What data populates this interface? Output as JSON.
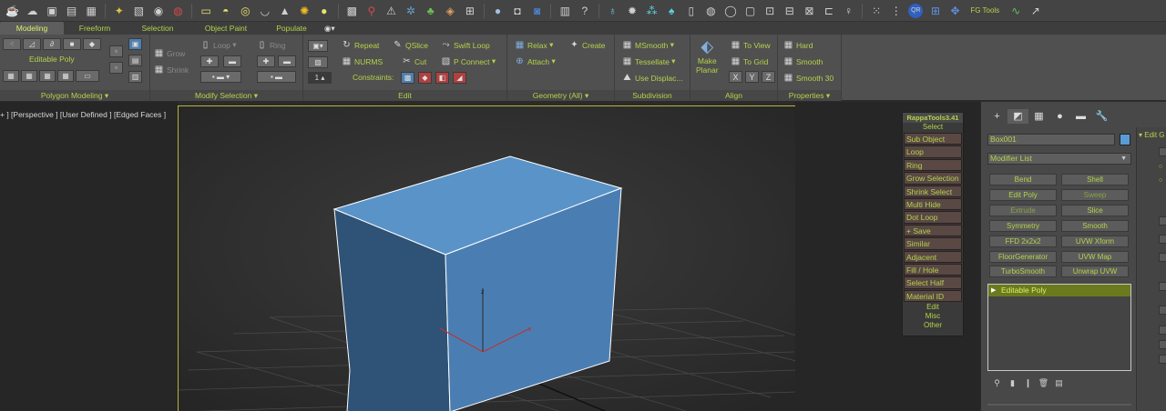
{
  "toolbar": {
    "icons": [
      "teapot-icon",
      "cloud-icon",
      "render-frame-icon",
      "list-icon",
      "layers-icon",
      "magnet-icon",
      "scene-icon",
      "camera-icon",
      "box-icon",
      "dome-icon",
      "ring-icon",
      "bowl-icon",
      "cone-icon",
      "sun-icon",
      "sphere-icon",
      "checker-icon",
      "lollipop-icon",
      "tripod-icon",
      "gear-icon",
      "plant-icon",
      "fish-icon",
      "hdri-icon",
      "ball-icon",
      "camera-gear-icon",
      "render-icon",
      "panel-icon",
      "help-icon",
      "bulb-icon",
      "sun2-icon",
      "grass-icon",
      "tree-icon",
      "book-icon",
      "hole-icon",
      "ring2-icon",
      "frame-icon",
      "crop-icon",
      "fit-icon",
      "expand-icon",
      "minimize-icon",
      "lamp-icon",
      "grid-icon",
      "dots-icon",
      "qr-icon",
      "matrix-icon",
      "move-icon"
    ],
    "fg_tools_label": "FG Tools"
  },
  "ribbon_tabs": [
    {
      "label": "Modeling"
    },
    {
      "label": "Freeform"
    },
    {
      "label": "Selection"
    },
    {
      "label": "Object Paint"
    },
    {
      "label": "Populate"
    }
  ],
  "ribbon": {
    "polygon_modeling": {
      "editable_poly": "Editable Poly",
      "title": "Polygon Modeling"
    },
    "modify_selection": {
      "grow": "Grow",
      "shrink": "Shrink",
      "loop": "Loop",
      "ring": "Ring",
      "title": "Modify Selection"
    },
    "edit": {
      "repeat": "Repeat",
      "qslice": "QSlice",
      "swift_loop": "Swift Loop",
      "nurms": "NURMS",
      "cut": "Cut",
      "p_connect": "P Connect",
      "constraints": "Constraints:",
      "spinner_value": "1",
      "title": "Edit"
    },
    "geometry": {
      "relax": "Relax",
      "create": "Create",
      "attach": "Attach",
      "title": "Geometry (All)"
    },
    "subdivision": {
      "msmooth": "MSmooth",
      "tessellate": "Tessellate",
      "use_displace": "Use Displac...",
      "title": "Subdivision"
    },
    "align": {
      "make_planar": "Make",
      "make_planar2": "Planar",
      "to_view": "To View",
      "to_grid": "To Grid",
      "x": "X",
      "y": "Y",
      "z": "Z",
      "title": "Align"
    },
    "properties": {
      "hard": "Hard",
      "smooth": "Smooth",
      "smooth30": "Smooth 30",
      "title": "Properties"
    }
  },
  "viewport": {
    "label": "+ ] [Perspective ] [User Defined ] [Edged Faces ]",
    "gizmo_x": "x",
    "gizmo_z": "z",
    "box_color": "#5b9bd5"
  },
  "rappatools": {
    "title": "RappaTools3.41",
    "select_label": "Select",
    "items": [
      "Sub Object",
      "Loop",
      "Ring",
      "Grow Selection",
      "Shrink Select",
      "Multi Hide",
      "Dot Loop",
      "+ Save",
      "Similar",
      "Adjacent",
      "Fill / Hole",
      "Select Half",
      "Material ID"
    ],
    "edit_label": "Edit",
    "misc_label": "Misc",
    "other_label": "Other"
  },
  "command_panel": {
    "object_name": "Box001",
    "modifier_list": "Modifier List",
    "modifiers": [
      [
        "Bend",
        "Shell"
      ],
      [
        "Edit Poly",
        "Sweep"
      ],
      [
        "Extrude",
        "Slice"
      ],
      [
        "Symmetry",
        "Smooth"
      ],
      [
        "FFD 2x2x2",
        "UVW Xform"
      ],
      [
        "FloorGenerator",
        "UVW Map"
      ],
      [
        "TurboSmooth",
        "Unwrap UVW"
      ]
    ],
    "stack_item": "Editable Poly",
    "rollout_title": "Edit G"
  }
}
